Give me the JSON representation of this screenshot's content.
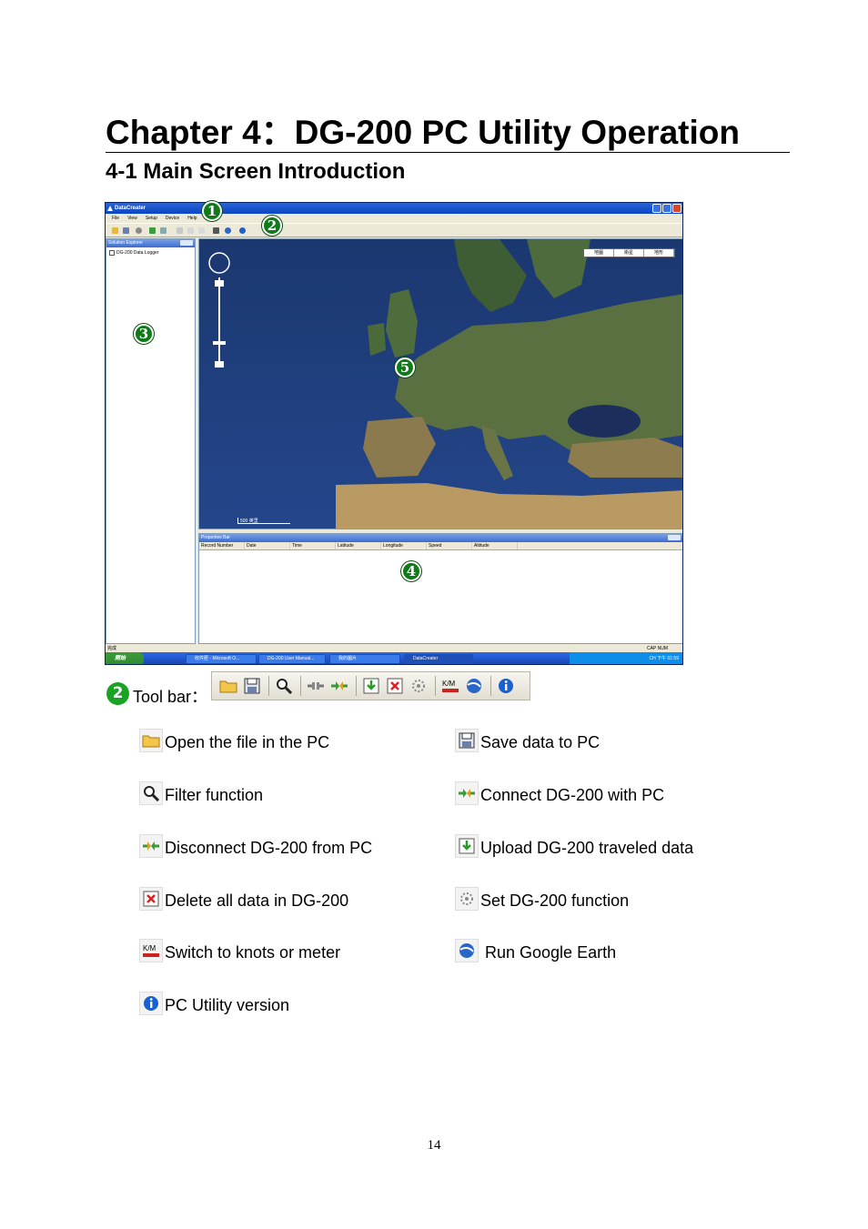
{
  "heading": {
    "chapter": "Chapter 4：DG-200 PC Utility Operation",
    "section": "4-1 Main Screen Introduction"
  },
  "app_screenshot": {
    "window_title": "DataCreater",
    "menu": [
      "File",
      "View",
      "Setup",
      "Device",
      "Help"
    ],
    "sidebar_title": "Solution Explorer",
    "tree_item": "DG-200 Data Logger",
    "map_types": [
      "地圖",
      "衛星",
      "地形"
    ],
    "map_scale": "500 英里",
    "properties_title": "Properties Bar",
    "properties_columns": [
      "Record Number",
      "Date",
      "Time",
      "Latitude",
      "Longitude",
      "Speed",
      "Altitude"
    ],
    "status_left": "完成",
    "status_right": "CAP  NUM",
    "start_label": "開始",
    "taskbar_items": [
      "收件匣 - Microsoft O...",
      "DG-200 User Manual...",
      "我的圖片",
      "DataCreater"
    ],
    "tray_text": "CH  下午 01:59"
  },
  "markers": [
    "1",
    "2",
    "3",
    "4",
    "5"
  ],
  "toolbar_caption": {
    "number": "2",
    "label": "Tool bar："
  },
  "legend": [
    {
      "icon": "folder-icon",
      "text": "Open the file in the PC"
    },
    {
      "icon": "save-icon",
      "text": "Save data to PC"
    },
    {
      "icon": "magnifier-icon",
      "text": "Filter function"
    },
    {
      "icon": "connect-icon",
      "text": "Connect DG-200 with PC"
    },
    {
      "icon": "disconnect-icon",
      "text": "Disconnect DG-200 from PC"
    },
    {
      "icon": "upload-icon",
      "text": "Upload DG-200 traveled data"
    },
    {
      "icon": "delete-icon",
      "text": "Delete all data in DG-200"
    },
    {
      "icon": "gear-icon",
      "text": "Set DG-200 function"
    },
    {
      "icon": "knots-meter-icon",
      "text": "Switch to knots or meter"
    },
    {
      "icon": "google-earth-icon",
      "text": " Run Google Earth"
    },
    {
      "icon": "info-icon",
      "text": "PC Utility version"
    }
  ],
  "page_number": "14"
}
